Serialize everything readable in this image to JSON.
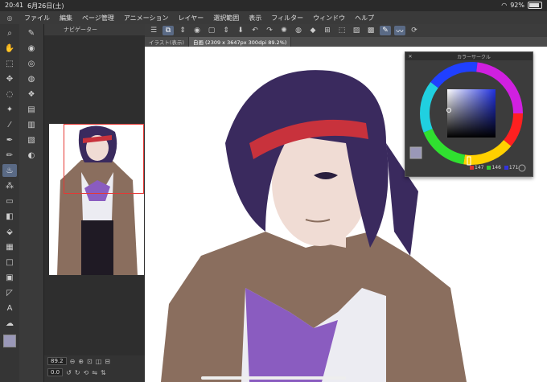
{
  "status": {
    "time": "20:41",
    "date": "6月26日(土)",
    "battery": "92%"
  },
  "menu": [
    "ファイル",
    "編集",
    "ページ管理",
    "アニメーション",
    "レイヤー",
    "選択範囲",
    "表示",
    "フィルター",
    "ウィンドウ",
    "ヘルプ"
  ],
  "navigator": {
    "tab_label": "ナビゲーター",
    "zoom": "89.2",
    "angle": "0.0"
  },
  "tabs": [
    "イラスト(表示)",
    "自画 (2309 x 3647px 300dpi 89.2%)"
  ],
  "color_panel": {
    "title": "カラーサークル",
    "r": "147",
    "g": "146",
    "b": "171"
  },
  "colors": {
    "accent": "#5a6a85",
    "selection_frame": "#e53935",
    "hair": "#3a2a5e",
    "headband": "#c8323c",
    "coat": "#8a6e5e",
    "shirt_purple": "#8a5cc0"
  }
}
